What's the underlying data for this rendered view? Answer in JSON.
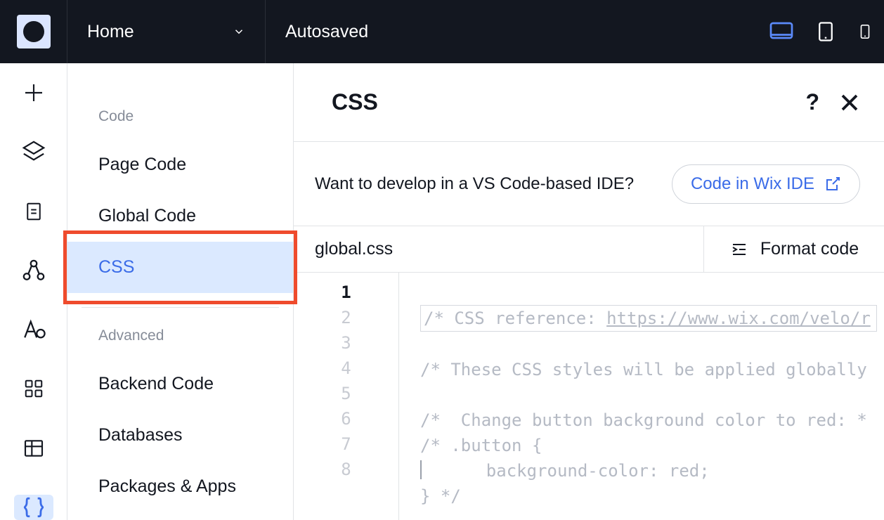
{
  "topbar": {
    "home_label": "Home",
    "status": "Autosaved"
  },
  "sidebar": {
    "section_code_label": "Code",
    "section_advanced_label": "Advanced",
    "items": {
      "page_code": "Page Code",
      "global_code": "Global Code",
      "css": "CSS",
      "backend_code": "Backend Code",
      "databases": "Databases",
      "packages_apps": "Packages & Apps"
    }
  },
  "content": {
    "title": "CSS",
    "ide_prompt": "Want to develop in a VS Code-based IDE?",
    "ide_button_label": "Code in Wix IDE",
    "file_name": "global.css",
    "format_label": "Format code"
  },
  "editor": {
    "lines": [
      "/* CSS reference: https://www.wix.com/velo/r",
      "",
      "/* These CSS styles will be applied globally",
      "",
      "/*  Change button background color to red: *",
      "/* .button {",
      "    background-color: red;",
      "} */"
    ]
  }
}
